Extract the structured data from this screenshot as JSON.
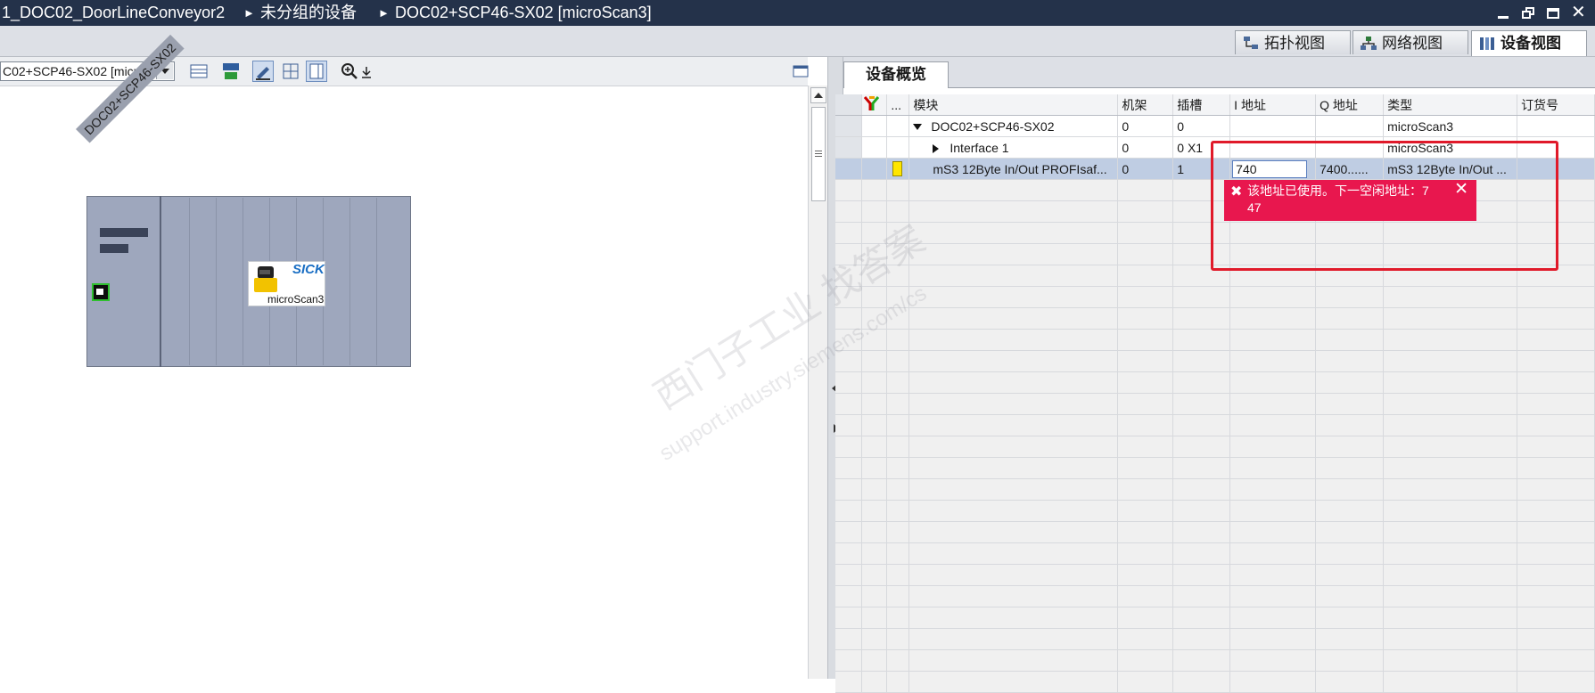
{
  "window": {
    "breadcrumbs": [
      "1_DOC02_DoorLineConveyor2",
      "未分组的设备",
      "DOC02+SCP46-SX02 [microScan3]"
    ]
  },
  "view_tabs": [
    {
      "label": "拓扑视图",
      "icon": "topology-icon"
    },
    {
      "label": "网络视图",
      "icon": "network-icon"
    },
    {
      "label": "设备视图",
      "icon": "device-icon",
      "active": true
    }
  ],
  "left_toolbar": {
    "device_select_value": "C02+SCP46-SX02 [microSc"
  },
  "device_graphic": {
    "station_label": "DOC02+SCP46-SX02",
    "module_brand": "SICK",
    "module_name": "microScan3"
  },
  "overview": {
    "tab_label": "设备概览",
    "columns": [
      "",
      "...",
      "模块",
      "机架",
      "插槽",
      "I 地址",
      "Q 地址",
      "类型",
      "订货号"
    ],
    "rows": [
      {
        "module": "DOC02+SCP46-SX02",
        "rack": "0",
        "slot": "0",
        "i_addr": "",
        "q_addr": "",
        "type": "microScan3",
        "order": ""
      },
      {
        "module": "Interface 1",
        "rack": "0",
        "slot": "0 X1",
        "i_addr": "",
        "q_addr": "",
        "type": "microScan3",
        "order": ""
      },
      {
        "module": "mS3 12Byte In/Out PROFIsaf...",
        "rack": "0",
        "slot": "1",
        "i_addr": "740",
        "q_addr": "7400......",
        "type": "mS3 12Byte In/Out ...",
        "order": ""
      }
    ],
    "empty_row_count": 24
  },
  "error_tooltip": {
    "line1": "该地址已使用。下一空闲地址：7",
    "line2": "47"
  },
  "watermark": {
    "line1": "西门子工业 找答案",
    "line2": "support.industry.siemens.com/cs"
  },
  "colors": {
    "titlebar_bg": "#24324a",
    "selected_row": "#bfcde3",
    "error_bg": "#e8174e",
    "annotation_red": "#e01a2a"
  }
}
